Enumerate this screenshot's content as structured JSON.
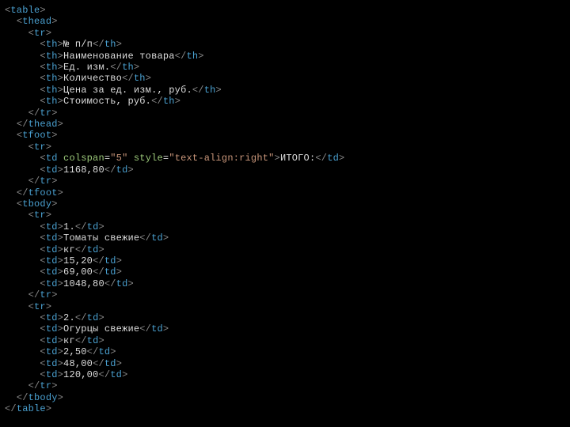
{
  "chart_data": {
    "type": "table",
    "headers": [
      "№ п/п",
      "Наименование товара",
      "Ед. изм.",
      "Количество",
      "Цена за ед. изм., руб.",
      "Стоимость, руб."
    ],
    "rows": [
      [
        "1.",
        "Томаты свежие",
        "кг",
        "15,20",
        "69,00",
        "1048,80"
      ],
      [
        "2.",
        "Огурцы свежие",
        "кг",
        "2,50",
        "48,00",
        "120,00"
      ]
    ],
    "footer": {
      "label": "ИТОГО:",
      "total": "1168,80"
    }
  },
  "tags": {
    "table": "table",
    "thead": "thead",
    "tbody": "tbody",
    "tfoot": "tfoot",
    "tr": "tr",
    "th": "th",
    "td": "td"
  },
  "attr": {
    "colspan_name": "colspan",
    "colspan_val": "\"5\"",
    "style_name": "style",
    "style_val": "\"text-align:right\""
  }
}
